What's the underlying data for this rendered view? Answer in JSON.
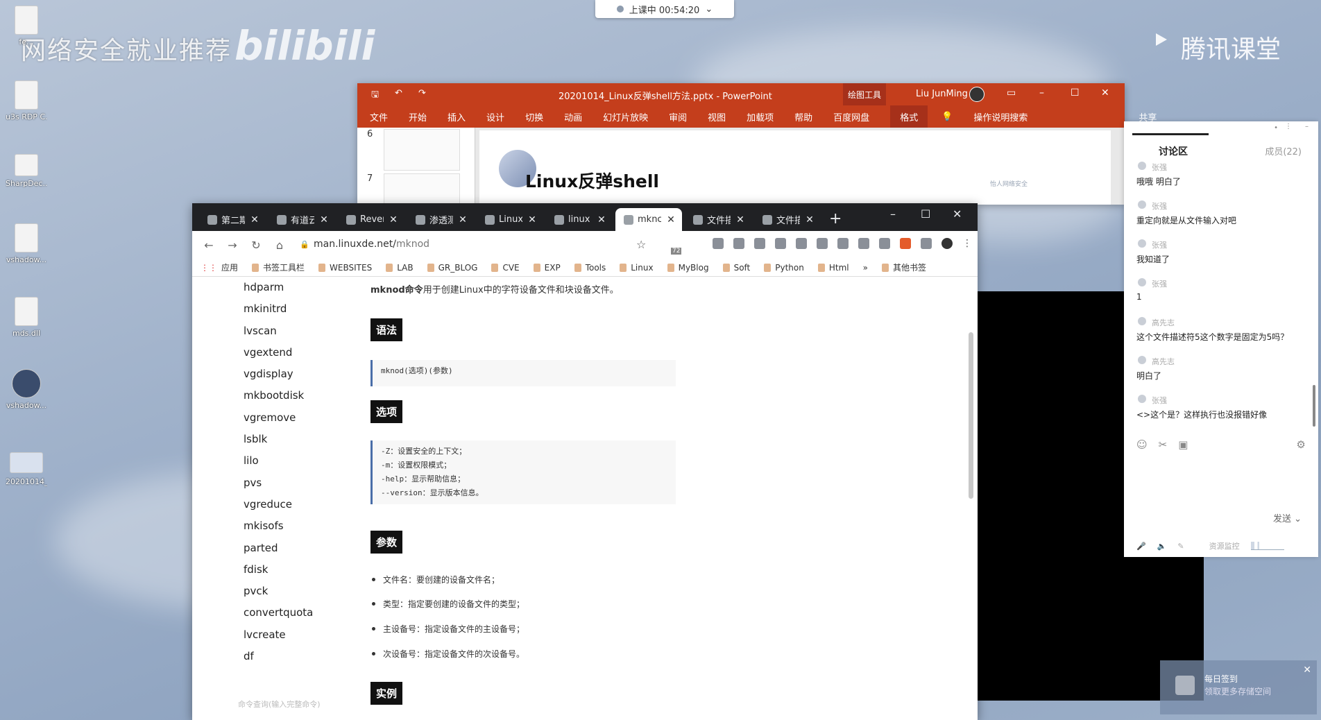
{
  "topbar": {
    "status": "上课中 00:54:20",
    "caret": "⌄"
  },
  "watermark": {
    "left_text": "网络安全就业推荐",
    "bili": "bilibili",
    "right_text": "腾讯课堂"
  },
  "desktop_icons": [
    {
      "label": "fe..."
    },
    {
      "label": "u3s RDP C..."
    },
    {
      "label": "SharpDec..."
    },
    {
      "label": "vshadow..."
    },
    {
      "label": "mds.dll"
    },
    {
      "label": "vshadow..."
    },
    {
      "label": "20201014_反弹shell..."
    }
  ],
  "ppt": {
    "title": "20201014_Linux反弹shell方法.pptx  -  PowerPoint",
    "drawing_tools": "绘图工具",
    "user": "Liu JunMing",
    "ribbon": [
      "文件",
      "开始",
      "插入",
      "设计",
      "切换",
      "动画",
      "幻灯片放映",
      "审阅",
      "视图",
      "加载项",
      "帮助",
      "百度网盘"
    ],
    "format_tab": "格式",
    "tell_me": "操作说明搜索",
    "share": "共享",
    "thumb_numbers": [
      "6",
      "7"
    ],
    "slide_title": "Linux反弹shell",
    "slide_badge": "怡人网络安全"
  },
  "browser": {
    "tabs": [
      {
        "label": "第二期"
      },
      {
        "label": "有道云"
      },
      {
        "label": "Rever"
      },
      {
        "label": "渗透测"
      },
      {
        "label": "Linux"
      },
      {
        "label": "linux"
      },
      {
        "label": "mknc"
      },
      {
        "label": "文件描"
      },
      {
        "label": "文件描"
      }
    ],
    "new_tab": "+",
    "url_host": "man.linuxde.net/",
    "url_path": "mknod",
    "ext_badge": "72",
    "bookmarks": [
      "应用",
      "书签工具栏",
      "WEBSITES",
      "LAB",
      "GR_BLOG",
      "CVE",
      "EXP",
      "Tools",
      "Linux",
      "MyBlog",
      "Soft",
      "Python",
      "Html"
    ],
    "bookmarks_more": "»",
    "bookmarks_other": "其他书签",
    "sidebar": [
      "hdparm",
      "mkinitrd",
      "lvscan",
      "vgextend",
      "vgdisplay",
      "mkbootdisk",
      "vgremove",
      "lsblk",
      "lilo",
      "pvs",
      "vgreduce",
      "mkisofs",
      "parted",
      "fdisk",
      "pvck",
      "convertquota",
      "lvcreate",
      "df"
    ],
    "sidebar_footer": "命令查询(输入完整命令)",
    "intro_bold": "mknod命令",
    "intro_rest": "用于创建Linux中的字符设备文件和块设备文件。",
    "h_syntax": "语法",
    "syntax_code": "mknod(选项)(参数)",
    "h_options": "选项",
    "options": [
      "-Z：设置安全的上下文；",
      "-m：设置权限模式；",
      "-help：显示帮助信息；",
      "--version：显示版本信息。"
    ],
    "h_params": "参数",
    "params": [
      "文件名：要创建的设备文件名；",
      "类型：指定要创建的设备文件的类型；",
      "主设备号：指定设备文件的主设备号；",
      "次设备号：指定设备文件的次设备号。"
    ],
    "h_example": "实例"
  },
  "chat": {
    "tab": "讨论区",
    "members": "成员(22)",
    "messages": [
      {
        "name": "张强",
        "text": "哦哦 明白了"
      },
      {
        "name": "张强",
        "text": "重定向就是从文件输入对吧"
      },
      {
        "name": "张强",
        "text": "我知道了"
      },
      {
        "name": "张强",
        "text": "1"
      },
      {
        "name": "高先志",
        "text": "这个文件描述符5这个数字是固定为5吗？"
      },
      {
        "name": "高先志",
        "text": "明白了"
      },
      {
        "name": "张强",
        "text": "<>这个是？这样执行也没报错好像"
      }
    ],
    "send": "发送",
    "resource": "资源监控"
  },
  "toast": {
    "line1": "每日签到",
    "line2": "领取更多存储空间",
    "close": "✕"
  }
}
